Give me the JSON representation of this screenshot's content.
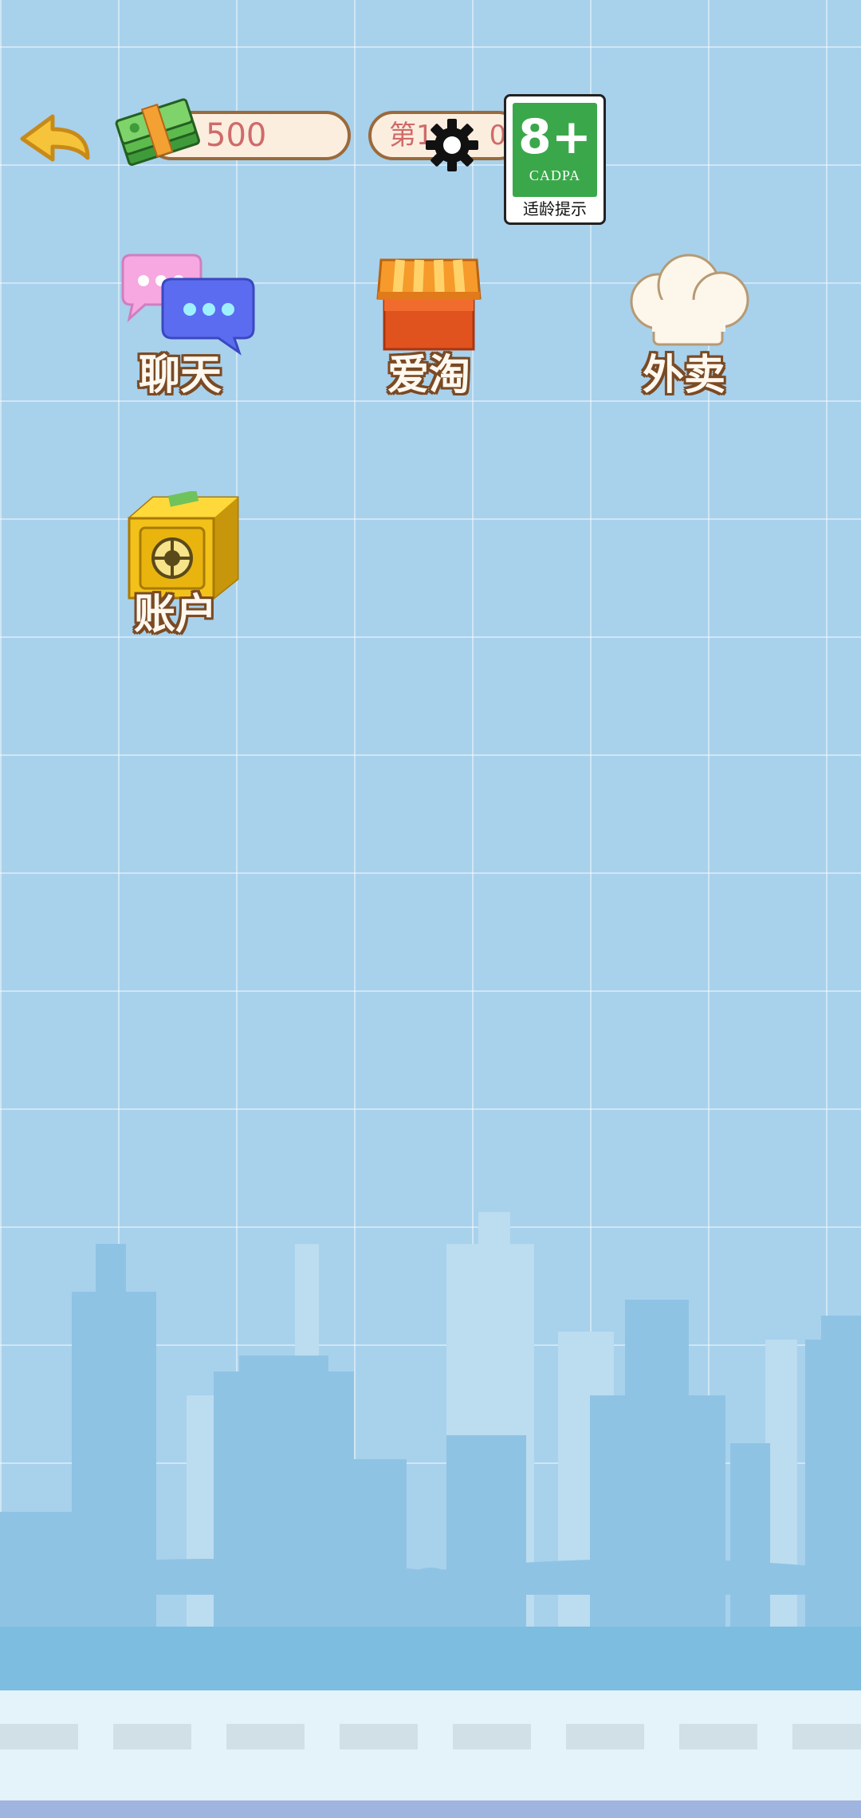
{
  "header": {
    "money_value": "500",
    "level_text": "第1",
    "level_suffix": "00",
    "age_rating": "8+",
    "age_org": "CADPA",
    "age_caption": "适龄提示"
  },
  "icons": {
    "back": "back-arrow-icon",
    "money": "cash-stack-icon",
    "settings": "gear-icon"
  },
  "apps": [
    {
      "label": "聊天",
      "icon": "chat-bubbles-icon"
    },
    {
      "label": "爱淘",
      "icon": "shop-awning-icon"
    },
    {
      "label": "外卖",
      "icon": "chef-hat-icon"
    },
    {
      "label": "账户",
      "icon": "safe-icon"
    }
  ],
  "colors": {
    "background": "#a8d1ec",
    "pill_border": "#9b6a3b",
    "pill_text": "#d06a6a",
    "label_outline": "#7a4a24"
  }
}
